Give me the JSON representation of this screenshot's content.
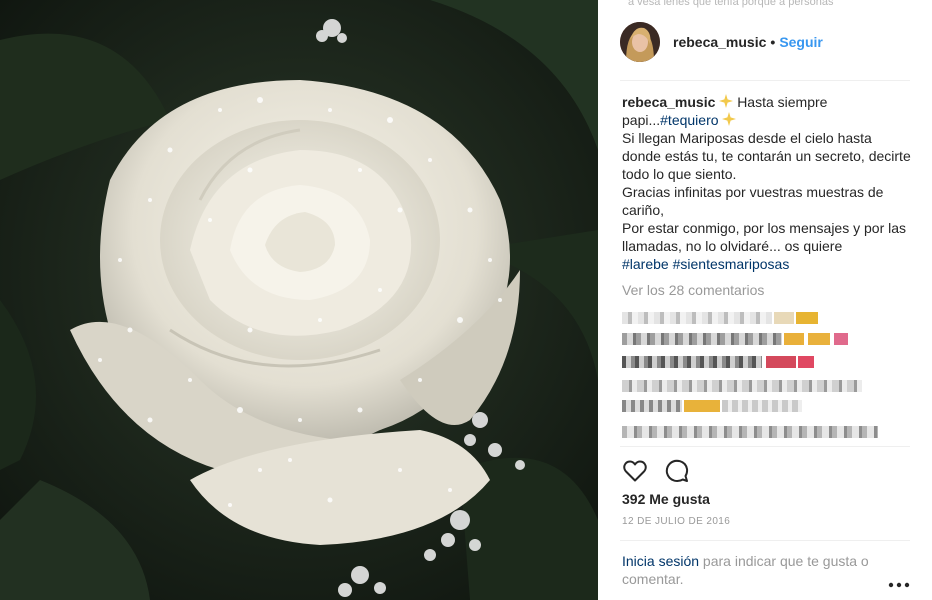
{
  "post": {
    "top_strip_text": "a vesa lenes que tenía porque a personas",
    "username": "rebeca_music",
    "dot": "•",
    "follow_label": "Seguir",
    "caption": {
      "username": "rebeca_music",
      "line1_text": " Hasta siempre papi...",
      "hashtag1": "#tequiero",
      "body1": "Si llegan Mariposas desde el cielo hasta donde estás tu, te contarán un secreto, decirte todo lo que siento.",
      "body2": "Gracias infinitas por vuestras muestras de cariño,",
      "body3": "Por estar conmigo, por los mensajes y por las llamadas, no lo olvidaré... os quiere",
      "hashtag2": "#larebe",
      "hashtag3": "#sientesmariposas",
      "emoji_name": "sparkle-star-icon"
    },
    "view_comments_label": "Ver los 28 comentarios",
    "likes_label": "392 Me gusta",
    "date_label": "12 de julio de 2016",
    "login_link_label": "Inicia sesión",
    "login_rest": " para indicar que te gusta o comentar.",
    "icons": [
      "heart-icon",
      "comment-icon",
      "more-options-icon"
    ]
  },
  "colors": {
    "link_blue": "#3897f0",
    "hashtag": "#003569",
    "muted": "#999999",
    "text": "#262626"
  }
}
